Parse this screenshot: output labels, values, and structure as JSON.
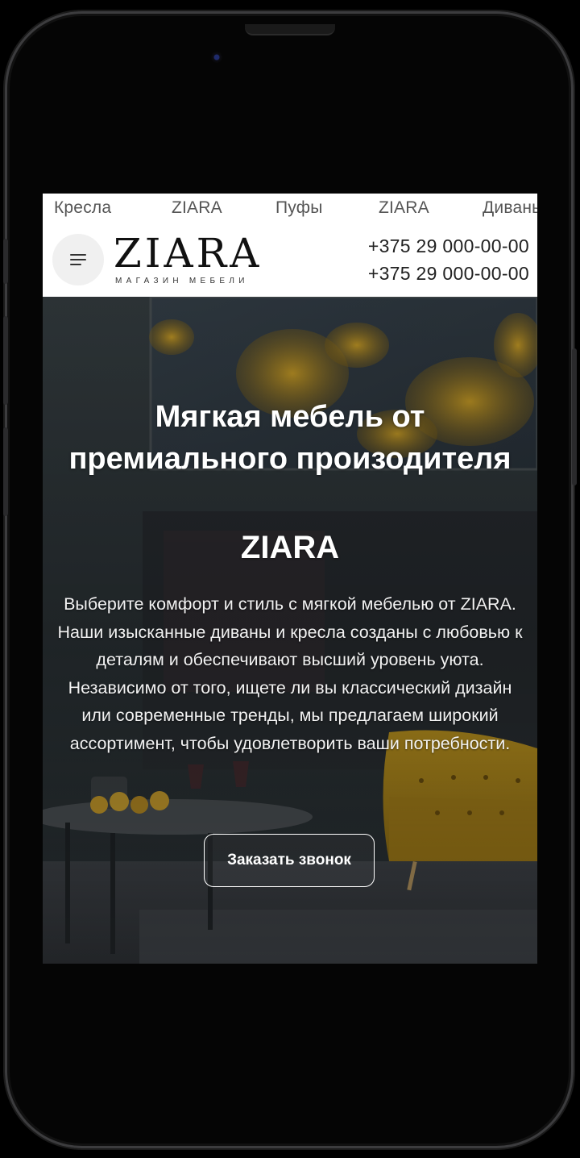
{
  "category_strip": {
    "items": [
      "Кресла",
      "ZIARA",
      "Пуфы",
      "ZIARA",
      "Диваны"
    ]
  },
  "header": {
    "logo_text": "ZIARA",
    "logo_subtitle": "МАГАЗИН МЕБЕЛИ",
    "phones": [
      "+375 29 000-00-00",
      "+375 29 000-00-00"
    ]
  },
  "hero": {
    "title": "Мягкая мебель от премиального произодителя",
    "brand": "ZIARA",
    "description": "Выберите комфорт и стиль с мягкой мебелью от ZIARA. Наши изысканные диваны и кресла созданы с любовью к деталям и обеспечивают высший уровень уюта. Независимо от того, ищете ли вы классический дизайн или современные тренды, мы предлагаем широкий ассортимент, чтобы удовлетворить ваши потребности.",
    "cta_label": "Заказать звонок"
  },
  "colors": {
    "accent_yellow": "#c9a020",
    "wall_dark": "#2f383d",
    "text_on_hero": "#ffffff"
  },
  "icons": {
    "menu": "hamburger-icon"
  }
}
